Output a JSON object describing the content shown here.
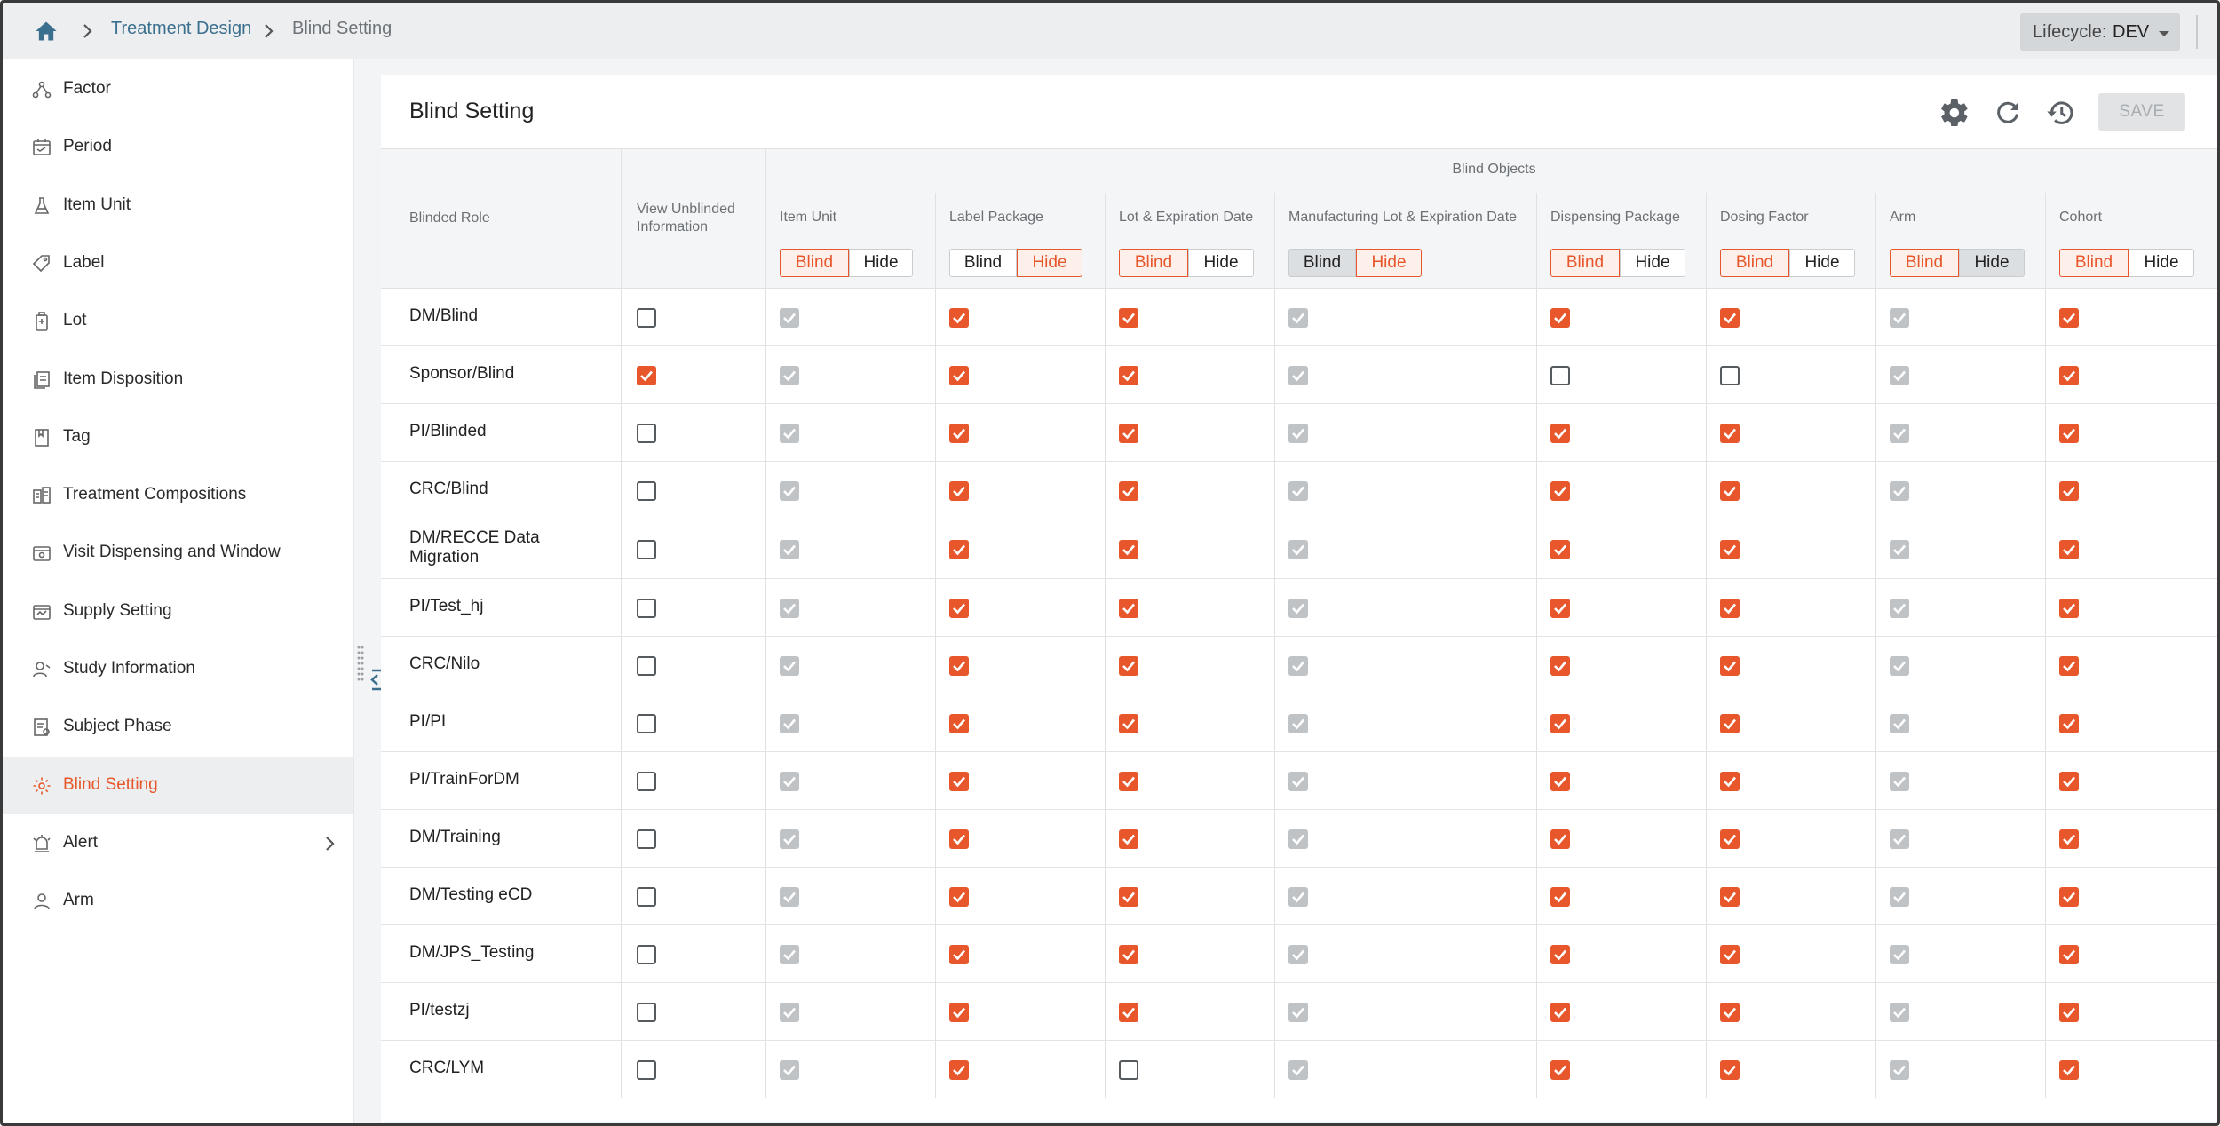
{
  "breadcrumb": {
    "home_icon": "home-icon",
    "items": [
      "Treatment Design",
      "Blind Setting"
    ]
  },
  "lifecycle": {
    "label": "Lifecycle:",
    "value": "DEV"
  },
  "sidebar": {
    "items": [
      {
        "label": "Factor",
        "icon": "factor-icon"
      },
      {
        "label": "Period",
        "icon": "calendar-icon"
      },
      {
        "label": "Item Unit",
        "icon": "flask-icon"
      },
      {
        "label": "Label",
        "icon": "tag-icon"
      },
      {
        "label": "Lot",
        "icon": "bottle-icon"
      },
      {
        "label": "Item Disposition",
        "icon": "document-icon"
      },
      {
        "label": "Tag",
        "icon": "bookmark-icon"
      },
      {
        "label": "Treatment Compositions",
        "icon": "composition-icon"
      },
      {
        "label": "Visit Dispensing and Window",
        "icon": "visit-icon"
      },
      {
        "label": "Supply Setting",
        "icon": "supply-icon"
      },
      {
        "label": "Study Information",
        "icon": "study-icon"
      },
      {
        "label": "Subject Phase",
        "icon": "phase-icon"
      },
      {
        "label": "Blind Setting",
        "icon": "gear-icon",
        "active": true
      },
      {
        "label": "Alert",
        "icon": "alarm-icon",
        "has_submenu": true
      },
      {
        "label": "Arm",
        "icon": "person-icon"
      }
    ]
  },
  "panel": {
    "title": "Blind Setting",
    "save_label": "SAVE",
    "header_icons": [
      "settings-icon",
      "refresh-icon",
      "history-icon"
    ]
  },
  "table": {
    "col_role": "Blinded Role",
    "col_view_line1": "View Unblinded",
    "col_view_line2": "Information",
    "group_title": "Blind Objects",
    "blind_label": "Blind",
    "hide_label": "Hide",
    "objects": [
      {
        "name": "Item Unit",
        "selected": "Blind",
        "grey": false
      },
      {
        "name": "Label Package",
        "selected": "Hide",
        "grey": false
      },
      {
        "name": "Lot & Expiration Date",
        "selected": "Blind",
        "grey": false
      },
      {
        "name": "Manufacturing Lot & Expiration Date",
        "selected": "Hide",
        "grey": true
      },
      {
        "name": "Dispensing Package",
        "selected": "Blind",
        "grey": false
      },
      {
        "name": "Dosing Factor",
        "selected": "Blind",
        "grey": false
      },
      {
        "name": "Arm",
        "selected": "Blind",
        "grey": true
      },
      {
        "name": "Cohort",
        "selected": "Blind",
        "grey": false
      }
    ],
    "rows": [
      {
        "role": "DM/Blind",
        "view": false,
        "cells": [
          "g",
          "o",
          "o",
          "g",
          "o",
          "o",
          "g",
          "o"
        ]
      },
      {
        "role": "Sponsor/Blind",
        "view": true,
        "cells": [
          "g",
          "o",
          "o",
          "g",
          "u",
          "u",
          "g",
          "o"
        ]
      },
      {
        "role": "PI/Blinded",
        "view": false,
        "cells": [
          "g",
          "o",
          "o",
          "g",
          "o",
          "o",
          "g",
          "o"
        ]
      },
      {
        "role": "CRC/Blind",
        "view": false,
        "cells": [
          "g",
          "o",
          "o",
          "g",
          "o",
          "o",
          "g",
          "o"
        ]
      },
      {
        "role": "DM/RECCE Data Migration",
        "view": false,
        "cells": [
          "g",
          "o",
          "o",
          "g",
          "o",
          "o",
          "g",
          "o"
        ]
      },
      {
        "role": "PI/Test_hj",
        "view": false,
        "cells": [
          "g",
          "o",
          "o",
          "g",
          "o",
          "o",
          "g",
          "o"
        ]
      },
      {
        "role": "CRC/Nilo",
        "view": false,
        "cells": [
          "g",
          "o",
          "o",
          "g",
          "o",
          "o",
          "g",
          "o"
        ]
      },
      {
        "role": "PI/PI",
        "view": false,
        "cells": [
          "g",
          "o",
          "o",
          "g",
          "o",
          "o",
          "g",
          "o"
        ]
      },
      {
        "role": "PI/TrainForDM",
        "view": false,
        "cells": [
          "g",
          "o",
          "o",
          "g",
          "o",
          "o",
          "g",
          "o"
        ]
      },
      {
        "role": "DM/Training",
        "view": false,
        "cells": [
          "g",
          "o",
          "o",
          "g",
          "o",
          "o",
          "g",
          "o"
        ]
      },
      {
        "role": "DM/Testing eCD",
        "view": false,
        "cells": [
          "g",
          "o",
          "o",
          "g",
          "o",
          "o",
          "g",
          "o"
        ]
      },
      {
        "role": "DM/JPS_Testing",
        "view": false,
        "cells": [
          "g",
          "o",
          "o",
          "g",
          "o",
          "o",
          "g",
          "o"
        ]
      },
      {
        "role": "PI/testzj",
        "view": false,
        "cells": [
          "g",
          "o",
          "o",
          "g",
          "o",
          "o",
          "g",
          "o"
        ]
      },
      {
        "role": "CRC/LYM",
        "view": false,
        "cells": [
          "g",
          "o",
          "u",
          "g",
          "o",
          "o",
          "g",
          "o"
        ]
      }
    ]
  },
  "colors": {
    "accent": "#e8562b",
    "disabled_check": "#bfc3c6",
    "link": "#3a6f8e"
  }
}
